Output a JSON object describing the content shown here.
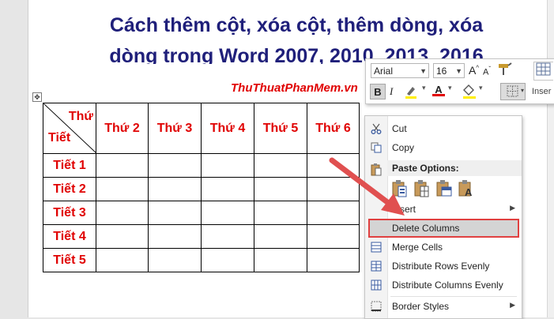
{
  "document": {
    "title_line1": "Cách thêm cột, xóa cột, thêm dòng, xóa",
    "title_line2": "dòng trong Word 2007, 2010, 2013, 2016",
    "site": "ThuThuatPhanMem.vn",
    "table": {
      "corner_top": "Thứ",
      "corner_bottom": "Tiết",
      "headers": [
        "Thứ 2",
        "Thứ 3",
        "Thứ 4",
        "Thứ 5",
        "Thứ 6"
      ],
      "rows": [
        "Tiết 1",
        "Tiết 2",
        "Tiết 3",
        "Tiết 4",
        "Tiết 5"
      ]
    }
  },
  "mini_toolbar": {
    "font": "Arial",
    "size": "16",
    "grow_font": "A",
    "shrink_font": "A",
    "bold": "B",
    "italic": "I",
    "font_color": "A",
    "insert_label": "Inser"
  },
  "context_menu": {
    "cut": "Cut",
    "copy": "Copy",
    "paste_options": "Paste Options:",
    "insert": "Insert",
    "delete_columns": "Delete Columns",
    "merge_cells": "Merge Cells",
    "distribute_rows": "Distribute Rows Evenly",
    "distribute_columns": "Distribute Columns Evenly",
    "border_styles": "Border Styles"
  },
  "colors": {
    "title": "#1f1f7a",
    "red_text": "#e00000",
    "highlight_border": "#e04040",
    "arrow": "#e05050"
  },
  "icons": [
    "move-handle-icon",
    "cut-icon",
    "copy-icon",
    "paste-icon",
    "merge-cells-icon",
    "distribute-rows-icon",
    "distribute-columns-icon",
    "border-styles-icon",
    "format-painter-icon",
    "table-icon"
  ]
}
